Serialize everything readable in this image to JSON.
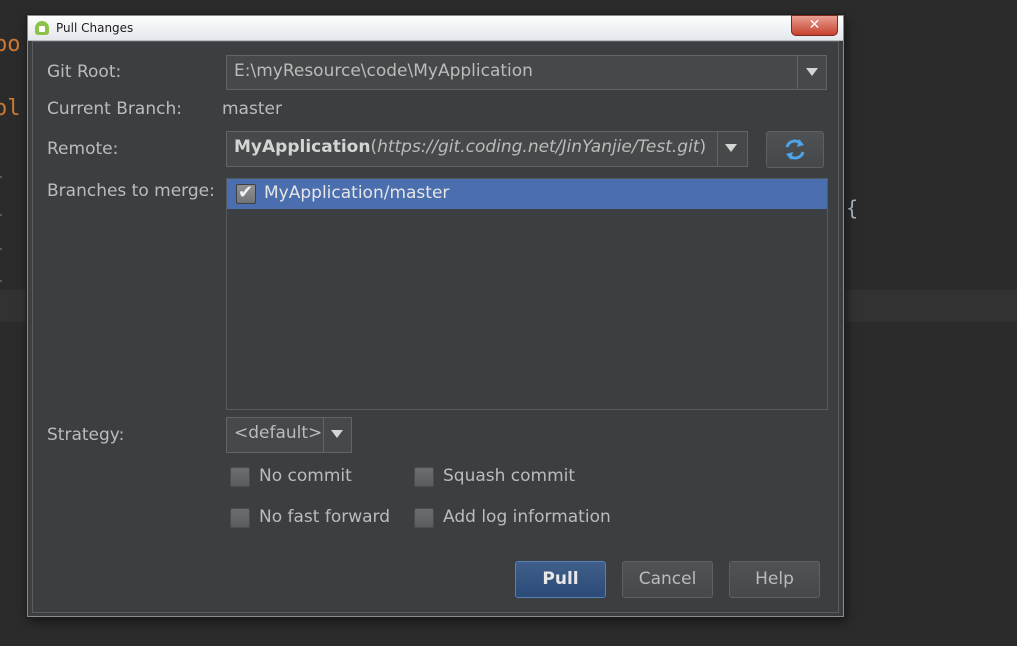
{
  "editor": {
    "fragment1": "po",
    "fragment2": "ol",
    "brace": "{"
  },
  "dialog": {
    "title": "Pull Changes",
    "close_glyph": "✕",
    "git_root": {
      "label": "Git Root:",
      "value": "E:\\myResource\\code\\MyApplication"
    },
    "current_branch": {
      "label": "Current Branch:",
      "value": "master"
    },
    "remote": {
      "label": "Remote:",
      "name": "MyApplication",
      "url_open": "(",
      "url": "https://git.coding.net/JinYanjie/Test.git",
      "url_close": ")"
    },
    "branches_to_merge": {
      "label": "Branches to merge:",
      "items": [
        {
          "name": "MyApplication/master",
          "checked": true
        }
      ]
    },
    "strategy": {
      "label": "Strategy:",
      "value": "<default>"
    },
    "options": {
      "no_commit": "No commit",
      "squash_commit": "Squash commit",
      "no_fast_forward": "No fast forward",
      "add_log_information": "Add log information"
    },
    "buttons": {
      "pull": "Pull",
      "cancel": "Cancel",
      "help": "Help"
    }
  },
  "colors": {
    "dialog_bg": "#3c3f41",
    "selection": "#4b6eaf",
    "primary_button": "#2b4a78",
    "text": "#bbbbbb",
    "close_button": "#c7402e"
  }
}
